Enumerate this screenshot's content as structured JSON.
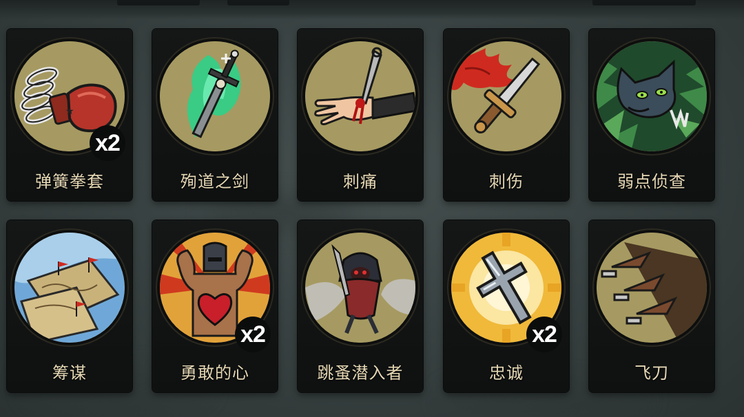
{
  "cards": [
    {
      "name": "弹簧拳套",
      "count": "x2",
      "icon": "spring-boxing-glove-icon"
    },
    {
      "name": "殉道之剑",
      "count": "",
      "icon": "martyr-sword-icon"
    },
    {
      "name": "刺痛",
      "count": "",
      "icon": "stabbed-hand-icon"
    },
    {
      "name": "刺伤",
      "count": "",
      "icon": "bloody-dagger-icon"
    },
    {
      "name": "弱点侦查",
      "count": "",
      "icon": "wolf-in-bushes-icon"
    },
    {
      "name": "筹谋",
      "count": "",
      "icon": "tactical-maps-icon"
    },
    {
      "name": "勇敢的心",
      "count": "x2",
      "icon": "brave-heart-warrior-icon"
    },
    {
      "name": "跳蚤潜入者",
      "count": "",
      "icon": "hooded-flea-assassin-icon"
    },
    {
      "name": "忠诚",
      "count": "x2",
      "icon": "silver-cross-icon"
    },
    {
      "name": "飞刀",
      "count": "",
      "icon": "throwing-knives-icon"
    }
  ],
  "colors": {
    "background": "#3a4343",
    "card": "#121414",
    "medallion": "#a49860",
    "label": "#e6d8b5",
    "badge": "#0b0c0c"
  }
}
